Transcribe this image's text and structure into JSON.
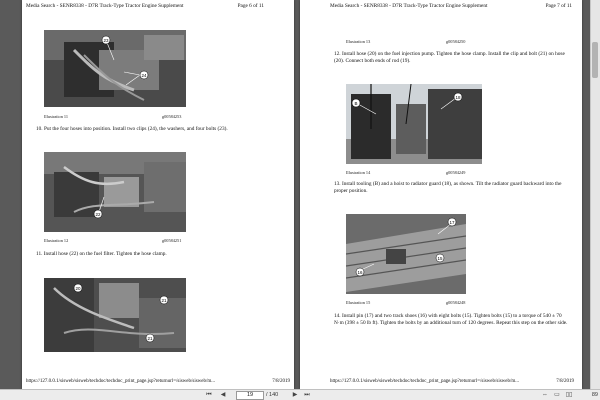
{
  "left_page": {
    "header_left": "Media Search - SENR8338 - D7R Track-Type Tractor Engine Supplement",
    "header_right": "Page 6 of 11",
    "ill11": {
      "title": "Illustration 11",
      "code": "g00584253"
    },
    "step10": "10.  Put the four hoses into position. Install two clips (24), the washers, and four bolts (23).",
    "ill12": {
      "title": "Illustration 12",
      "code": "g00584251"
    },
    "step11": "11.  Install hose (22) on the fuel filter. Tighten the hose clamp.",
    "footer_url": "https://127.0.0.1/sisweb/sisweb/techdoc/techdoc_print_page.jsp?returnurl=/sisweb/sisweb/m...",
    "footer_date": "7/8/2019",
    "callouts": {
      "c23": "23",
      "c24": "24",
      "c22": "22",
      "c20": "20",
      "c21": "21",
      "c21b": "21"
    }
  },
  "right_page": {
    "header_left": "Media Search - SENR8338 - D7R Track-Type Tractor Engine Supplement",
    "header_right": "Page 7 of 11",
    "ill13": {
      "title": "Illustration 13",
      "code": "g00584250"
    },
    "step12": "12.  Install hose (20) on the fuel injection pump. Tighten the hose clamp. Install the clip and bolt (21) on hose (20). Connect both ends of rod (19).",
    "ill14": {
      "title": "Illustration 14",
      "code": "g00584249"
    },
    "step13": "13.  Install tooling (B) and a hoist to radiator guard (18), as shown. Tilt the radiator guard backward into the proper position.",
    "ill15": {
      "title": "Illustration 15",
      "code": "g00584248"
    },
    "step14": "14.  Install pin (17) and two track shoes (16) with eight bolts (15). Tighten bolts (15) to a torque of 540 ± 70 N·m (398 ± 50 lb ft). Tighten the bolts by an additional turn of 120 degrees. Repeat this step on the other side.",
    "footer_url": "https://127.0.0.1/sisweb/sisweb/techdoc/techdoc_print_page.jsp?returnurl=/sisweb/sisweb/m...",
    "footer_date": "7/8/2019",
    "callouts": {
      "cB": "B",
      "c18": "18",
      "c17": "17",
      "c15": "15",
      "c16": "16"
    }
  },
  "toolbar": {
    "page_value": "19",
    "page_total": "/ 140",
    "zoom": "89"
  }
}
